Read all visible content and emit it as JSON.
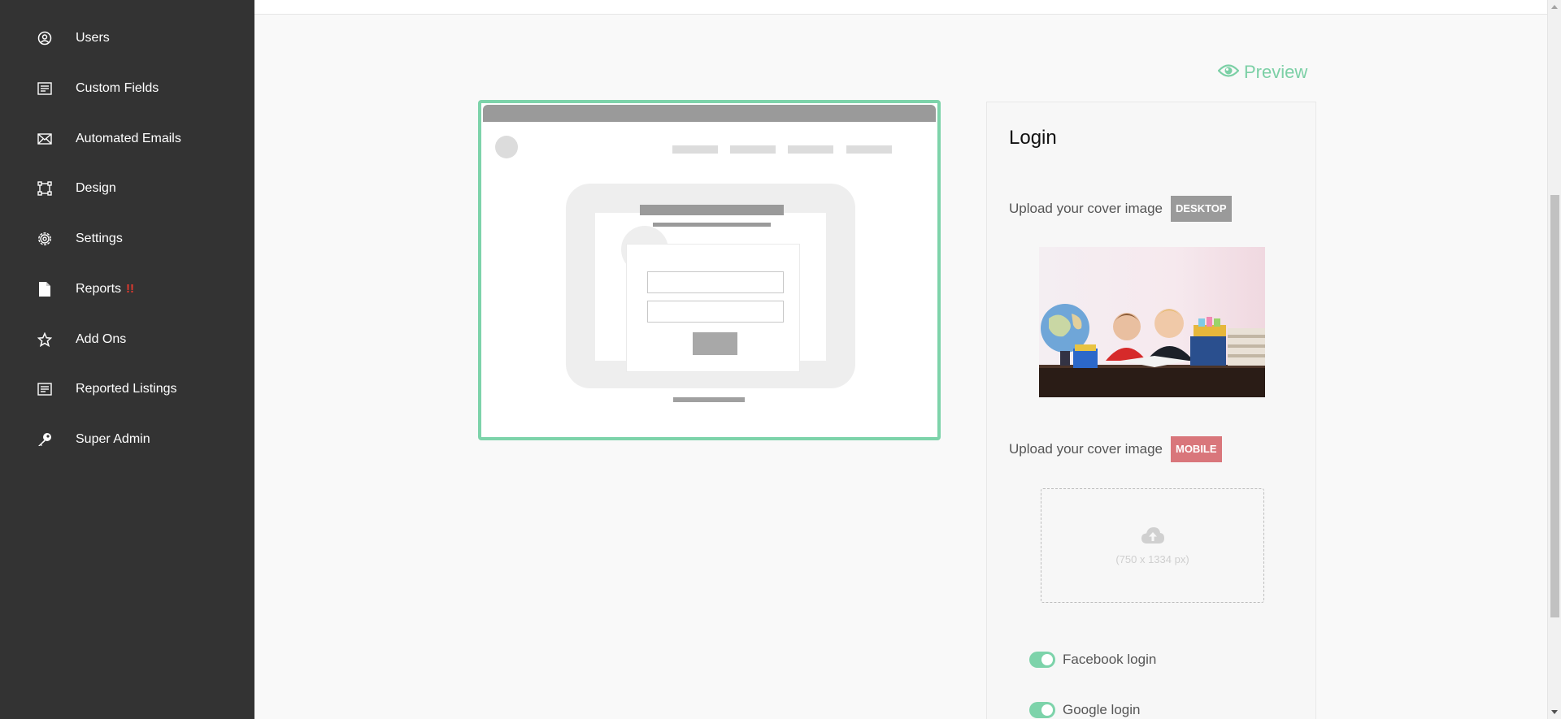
{
  "sidebar": {
    "items": [
      {
        "label": "Users",
        "icon": "user-circle-icon"
      },
      {
        "label": "Custom Fields",
        "icon": "list-form-icon"
      },
      {
        "label": "Automated Emails",
        "icon": "envelope-icon"
      },
      {
        "label": "Design",
        "icon": "design-frame-icon"
      },
      {
        "label": "Settings",
        "icon": "gear-icon"
      },
      {
        "label": "Reports",
        "icon": "document-icon",
        "alert": "!!"
      },
      {
        "label": "Add Ons",
        "icon": "star-icon"
      },
      {
        "label": "Reported Listings",
        "icon": "list-form-icon"
      },
      {
        "label": "Super Admin",
        "icon": "key-icon"
      }
    ]
  },
  "preview": {
    "label": "Preview",
    "icon": "eye-icon"
  },
  "panel": {
    "title": "Login",
    "desktop_upload": {
      "label": "Upload your cover image",
      "badge": "DESKTOP"
    },
    "mobile_upload": {
      "label": "Upload your cover image",
      "badge": "MOBILE",
      "hint": "(750 x 1334 px)",
      "icon": "cloud-upload-icon"
    },
    "toggles": [
      {
        "label": "Facebook login",
        "on": true
      },
      {
        "label": "Google login",
        "on": true
      }
    ]
  },
  "colors": {
    "sidebar_bg": "#333333",
    "accent_green": "#7dd3aa",
    "alert_red": "#e03a2f",
    "badge_desktop": "#9a9a9a",
    "badge_mobile": "#d9767b"
  }
}
